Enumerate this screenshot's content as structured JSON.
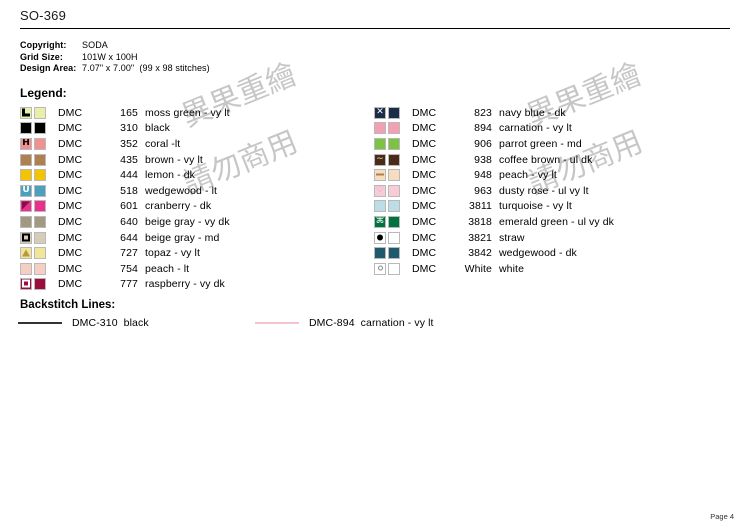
{
  "document": {
    "title": "SO-369",
    "footer": "Page 4"
  },
  "watermark": {
    "line1": "異果重繪",
    "line2": "請勿商用"
  },
  "meta": {
    "rows": [
      {
        "label": "Copyright:",
        "value": "SODA"
      },
      {
        "label": "Grid Size:",
        "value": "101W x 100H"
      },
      {
        "label": "Design Area:",
        "value": "7.07\" x 7.00\"  (99 x 98 stitches)"
      }
    ]
  },
  "legend": {
    "heading": "Legend:",
    "brand": "DMC",
    "left": [
      {
        "symbol": "corner",
        "symbol_color": "#000000",
        "swatch": "#e9eeaa",
        "code": "165",
        "name": "moss green - vy lt"
      },
      {
        "symbol": "blank",
        "symbol_color": "#000000",
        "swatch": "#000000",
        "code": "310",
        "name": "black"
      },
      {
        "symbol": "H",
        "symbol_color": "#000000",
        "swatch": "#f09090",
        "code": "352",
        "name": "coral -lt"
      },
      {
        "symbol": "blank",
        "symbol_color": "#000000",
        "swatch": "#b08050",
        "code": "435",
        "name": "brown - vy lt"
      },
      {
        "symbol": "blank",
        "symbol_color": "#000000",
        "swatch": "#f5c400",
        "code": "444",
        "name": "lemon - dk"
      },
      {
        "symbol": "U",
        "symbol_color": "#ffffff",
        "swatch": "#4da0bd",
        "code": "518",
        "name": "wedgewood - lt"
      },
      {
        "symbol": "flag",
        "symbol_color": "#8b0a4a",
        "swatch": "#e8308c",
        "code": "601",
        "name": "cranberry - dk"
      },
      {
        "symbol": "blank",
        "symbol_color": "#000000",
        "swatch": "#a39880",
        "code": "640",
        "name": "beige gray - vy dk"
      },
      {
        "symbol": "sqdot",
        "symbol_color": "#000000",
        "swatch": "#d5cdb8",
        "code": "644",
        "name": "beige gray - md"
      },
      {
        "symbol": "tri",
        "symbol_color": "#b59a40",
        "swatch": "#f2e49a",
        "code": "727",
        "name": "topaz - vy lt"
      },
      {
        "symbol": "blank",
        "symbol_color": "#000000",
        "swatch": "#f6cfc4",
        "code": "754",
        "name": "peach - lt"
      },
      {
        "symbol": "sqdot",
        "symbol_color": "#ffffff",
        "swatch": "#9c0d3c",
        "code": "777",
        "name": "raspberry - vy dk"
      }
    ],
    "right": [
      {
        "symbol": "X",
        "symbol_color": "#ffffff",
        "swatch": "#1c2b48",
        "code": "823",
        "name": "navy blue - dk"
      },
      {
        "symbol": "blank",
        "symbol_color": "#000000",
        "swatch": "#f4a0b4",
        "code": "894",
        "name": "carnation - vy lt"
      },
      {
        "symbol": "blank",
        "symbol_color": "#000000",
        "swatch": "#7dc242",
        "code": "906",
        "name": "parrot green - md"
      },
      {
        "symbol": "~",
        "symbol_color": "#f0e0d0",
        "swatch": "#4a2a18",
        "code": "938",
        "name": "coffee brown - ul dk"
      },
      {
        "symbol": "dash",
        "symbol_color": "#b08050",
        "swatch": "#f7ddc0",
        "code": "948",
        "name": "peach - vy lt"
      },
      {
        "symbol": "heart",
        "symbol_color": "#d080a0",
        "swatch": "#f6ccd8",
        "code": "963",
        "name": "dusty rose - ul vy lt"
      },
      {
        "symbol": "blank",
        "symbol_color": "#000000",
        "swatch": "#bcdde6",
        "code": "3811",
        "name": "turquoise - vy lt"
      },
      {
        "symbol": "cmd",
        "symbol_color": "#ffffff",
        "swatch": "#00723d",
        "code": "3818",
        "name": "emerald green - ul vy dk"
      },
      {
        "symbol": "dot",
        "symbol_color": "#000000",
        "swatch": "#edc košík",
        "code": "3821",
        "name": "straw"
      },
      {
        "symbol": "blank",
        "symbol_color": "#000000",
        "swatch": "#1d5a6e",
        "code": "3842",
        "name": "wedgewood - dk"
      },
      {
        "symbol": "ring",
        "symbol_color": "#888888",
        "swatch": "#ffffff",
        "code": "White",
        "name": "white"
      }
    ]
  },
  "backstitch": {
    "heading": "Backstitch Lines:",
    "rows": [
      {
        "color": "#333333",
        "label": "DMC-310  black"
      },
      {
        "color": "#f6c3cf",
        "label": "DMC-894  carnation - vy lt"
      }
    ]
  }
}
